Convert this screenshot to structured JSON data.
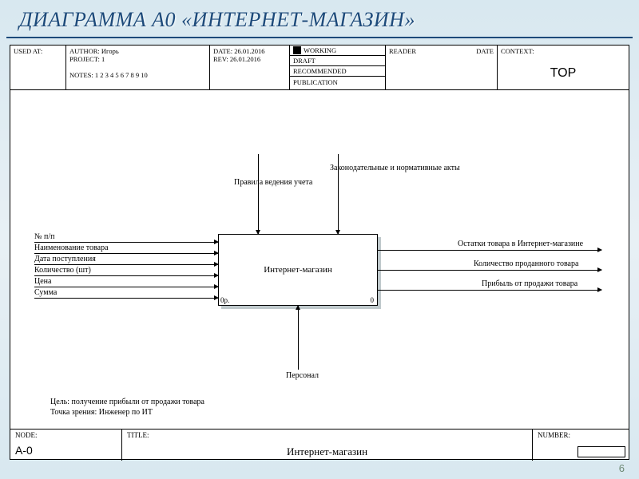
{
  "slide_title": "ДИАГРАММА А0 «ИНТЕРНЕТ-МАГАЗИН»",
  "header": {
    "used_at": "USED AT:",
    "author_lbl": "AUTHOR:",
    "author": "Игорь",
    "project_lbl": "PROJECT:",
    "project": "1",
    "notes_lbl": "NOTES:",
    "notes": "1  2  3  4  5  6  7  8  9  10",
    "date_lbl": "DATE:",
    "date": "26.01.2016",
    "rev_lbl": "REV:",
    "rev": "26.01.2016",
    "status": {
      "working": "WORKING",
      "draft": "DRAFT",
      "recommended": "RECOMMENDED",
      "publication": "PUBLICATION"
    },
    "reader_lbl": "READER",
    "reader_date_lbl": "DATE",
    "context_lbl": "CONTEXT:",
    "context_val": "TOP"
  },
  "box": {
    "name": "Интернет-магазин",
    "rate_left": "0р.",
    "rate_right": "0"
  },
  "controls": {
    "c1": "Правила ведения учета",
    "c2": "Законодательные и нормативные акты"
  },
  "mechanism": "Персонал",
  "inputs": {
    "i1": "№ п/п",
    "i2": "Наименование товара",
    "i3": "Дата поступления",
    "i4": "Количество (шт)",
    "i5": "Цена",
    "i6": "Сумма"
  },
  "outputs": {
    "o1": "Остатки товара в Интернет-магазине",
    "o2": "Количество проданного товара",
    "o3": "Прибыль от продажи товара"
  },
  "purpose": {
    "line1": "Цель: получение прибыли от продажи товара",
    "line2": "Точка зрения: Инженер по ИТ"
  },
  "footer": {
    "node_lbl": "NODE:",
    "node": "A-0",
    "title_lbl": "TITLE:",
    "title": "Интернет-магазин",
    "number_lbl": "NUMBER:"
  },
  "page_number": "6"
}
